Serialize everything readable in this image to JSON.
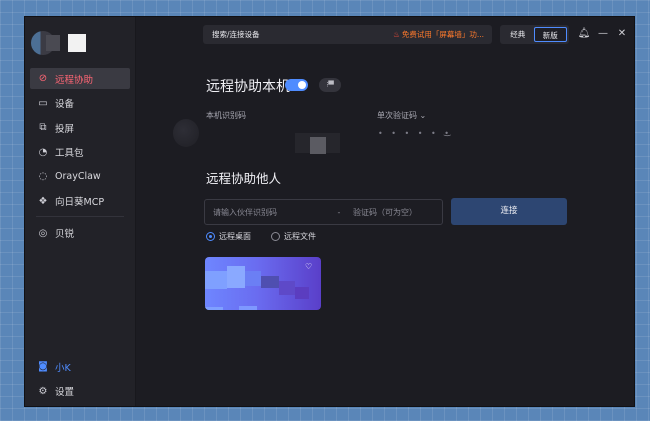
{
  "sidebar": {
    "items": [
      {
        "label": "远程协助",
        "icon": "remote-assist-icon",
        "glyph": "⊘",
        "active": true
      },
      {
        "label": "设备",
        "icon": "monitor-icon",
        "glyph": "▭"
      },
      {
        "label": "投屏",
        "icon": "cast-icon",
        "glyph": "⧉"
      },
      {
        "label": "工具包",
        "icon": "toolbox-icon",
        "glyph": "◔"
      },
      {
        "label": "OrayClaw",
        "icon": "claw-icon",
        "glyph": "◌"
      },
      {
        "label": "向日葵MCP",
        "icon": "mcp-icon",
        "glyph": "❖"
      }
    ],
    "items2": [
      {
        "label": "贝锐",
        "icon": "beirui-icon",
        "glyph": "◎"
      }
    ],
    "bottom": [
      {
        "label": "小K",
        "icon": "assistant-icon",
        "glyph": "◙"
      },
      {
        "label": "设置",
        "icon": "settings-icon",
        "glyph": "⚙"
      }
    ]
  },
  "topbar": {
    "search": "搜索/连接设备",
    "promo": "免费试用「屏幕墙」功...",
    "modes": [
      "经典",
      "新版"
    ],
    "active_mode": "新版"
  },
  "main": {
    "section1_title": "远程协助本机",
    "toggle_on": true,
    "chip_text": "⁝▀",
    "device_id_label": "本机识别码",
    "verify_label": "单次验证码",
    "verify_mask": "• • • • • •",
    "eye_glyph": "‿",
    "section2_title": "远程协助他人",
    "partner_placeholder": "请输入伙伴识别码",
    "separator": "-",
    "code_placeholder": "验证码（可为空）",
    "connect_button": "连接",
    "radio_options": [
      "远程桌面",
      "远程文件"
    ],
    "selected_radio": "远程桌面"
  },
  "colors": {
    "accent": "#4f8cff",
    "active_nav": "#ff6675",
    "promo": "#ff7a2c"
  }
}
